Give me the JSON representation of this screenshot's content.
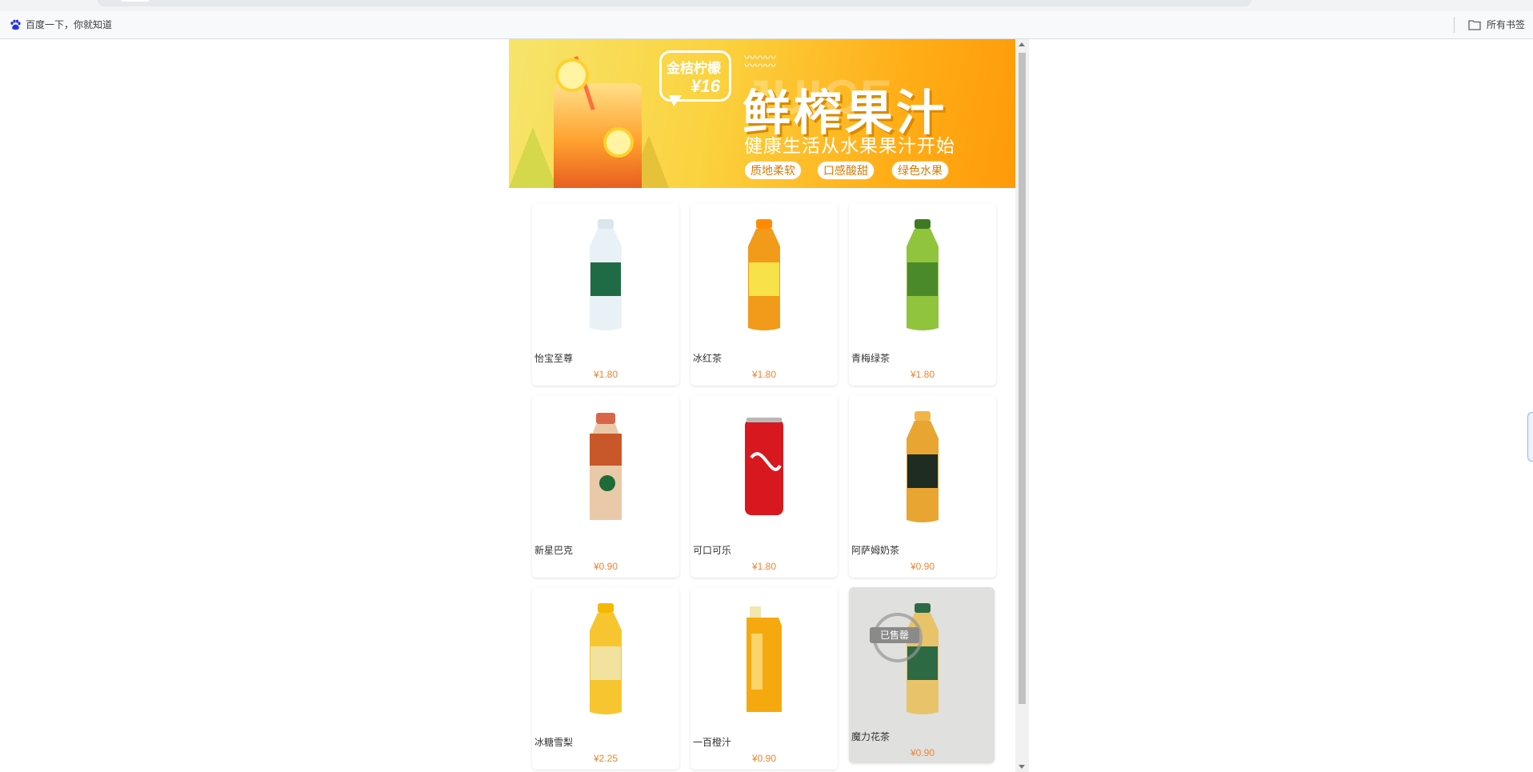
{
  "browser": {
    "bookmark_left": "百度一下，你就知道",
    "bookmark_right": "所有书签"
  },
  "banner": {
    "bubble_line1": "金桔柠檬",
    "bubble_line2": "¥16",
    "title": "鲜榨果汁",
    "ghost_text": "JUICE",
    "subtitle": "健康生活从水果果汁开始",
    "tags": [
      "质地柔软",
      "口感酸甜",
      "绿色水果"
    ]
  },
  "products": [
    {
      "name": "怡宝至尊",
      "price": "¥1.80",
      "sold_out": false,
      "colors": {
        "body": "#e8f2f6",
        "label": "#1f6b45",
        "cap": "#d9e6ec"
      }
    },
    {
      "name": "冰红茶",
      "price": "¥1.80",
      "sold_out": false,
      "colors": {
        "body": "#f29a1a",
        "label": "#f7e24a",
        "cap": "#ff8c00"
      }
    },
    {
      "name": "青梅绿茶",
      "price": "¥1.80",
      "sold_out": false,
      "colors": {
        "body": "#8fc43c",
        "label": "#4a8a2a",
        "cap": "#3d7a22"
      }
    },
    {
      "name": "新星巴克",
      "price": "¥0.90",
      "sold_out": false,
      "colors": {
        "body": "#e9c9a8",
        "label": "#c8572a",
        "cap": "#d9664a"
      }
    },
    {
      "name": "可口可乐",
      "price": "¥1.80",
      "sold_out": false,
      "colors": {
        "body": "#d7181f",
        "label": "#ffffff",
        "cap": "#b8b8b8"
      }
    },
    {
      "name": "阿萨姆奶茶",
      "price": "¥0.90",
      "sold_out": false,
      "colors": {
        "body": "#e8a531",
        "label": "#1e2c22",
        "cap": "#f2b548"
      }
    },
    {
      "name": "冰糖雪梨",
      "price": "¥2.25",
      "sold_out": false,
      "colors": {
        "body": "#f7c530",
        "label": "#f1e2a0",
        "cap": "#f5b800"
      }
    },
    {
      "name": "一百橙汁",
      "price": "¥0.90",
      "sold_out": false,
      "colors": {
        "body": "#f6a90e",
        "label": "#fbd46a",
        "cap": "#f1e7b0"
      }
    },
    {
      "name": "魔力花茶",
      "price": "¥0.90",
      "sold_out": true,
      "sold_label": "已售罄",
      "colors": {
        "body": "#e9c36a",
        "label": "#2d6a44",
        "cap": "#2d6a44"
      }
    }
  ]
}
